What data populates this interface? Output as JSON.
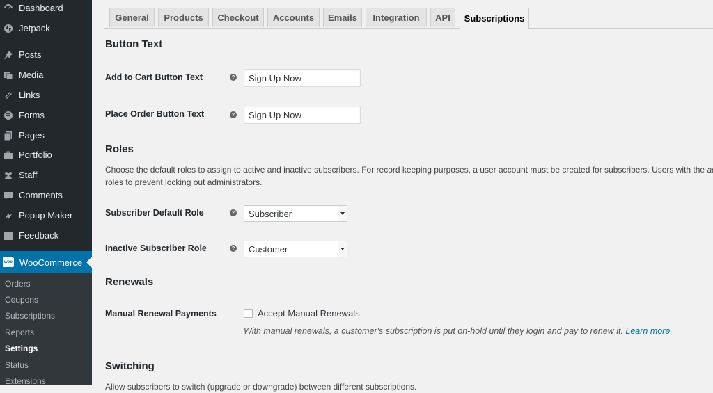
{
  "sidebar": {
    "items": [
      {
        "label": "Dashboard",
        "icon": "dashboard-icon"
      },
      {
        "label": "Jetpack",
        "icon": "jetpack-icon"
      },
      {
        "label": "Posts",
        "icon": "pin-icon"
      },
      {
        "label": "Media",
        "icon": "media-icon"
      },
      {
        "label": "Links",
        "icon": "link-icon"
      },
      {
        "label": "Forms",
        "icon": "forms-icon"
      },
      {
        "label": "Pages",
        "icon": "pages-icon"
      },
      {
        "label": "Portfolio",
        "icon": "portfolio-icon"
      },
      {
        "label": "Staff",
        "icon": "staff-icon"
      },
      {
        "label": "Comments",
        "icon": "comment-icon"
      },
      {
        "label": "Popup Maker",
        "icon": "popup-icon"
      },
      {
        "label": "Feedback",
        "icon": "feedback-icon"
      },
      {
        "label": "WooCommerce",
        "icon": "woocommerce-icon",
        "badge": "woo"
      }
    ],
    "submenu": [
      "Orders",
      "Coupons",
      "Subscriptions",
      "Reports",
      "Settings",
      "Status",
      "Extensions"
    ]
  },
  "tabs": [
    "General",
    "Products",
    "Checkout",
    "Accounts",
    "Emails",
    "Integration",
    "API",
    "Subscriptions"
  ],
  "sections": {
    "button_text": "Button Text",
    "roles": "Roles",
    "renewals": "Renewals",
    "switching": "Switching"
  },
  "fields": {
    "add_to_cart_label": "Add to Cart Button Text",
    "add_to_cart_value": "Sign Up Now",
    "place_order_label": "Place Order Button Text",
    "place_order_value": "Sign Up Now",
    "subscriber_role_label": "Subscriber Default Role",
    "subscriber_role_value": "Subscriber",
    "inactive_role_label": "Inactive Subscriber Role",
    "inactive_role_value": "Customer",
    "manual_renewal_label": "Manual Renewal Payments",
    "manual_renewal_checkbox": "Accept Manual Renewals",
    "help_glyph": "?"
  },
  "roles_desc": {
    "line1a": "Choose the default roles to assign to active and inactive subscribers. For record keeping purposes, a user account must be created for subscribers. Users with the ",
    "line1b": "adm",
    "line2": "roles to prevent locking out administrators."
  },
  "renewal_desc": {
    "text": "With manual renewals, a customer's subscription is put on-hold until they login and pay to renew it. ",
    "link": "Learn more",
    "after": "."
  },
  "switching_desc": "Allow subscribers to switch (upgrade or downgrade) between different subscriptions."
}
